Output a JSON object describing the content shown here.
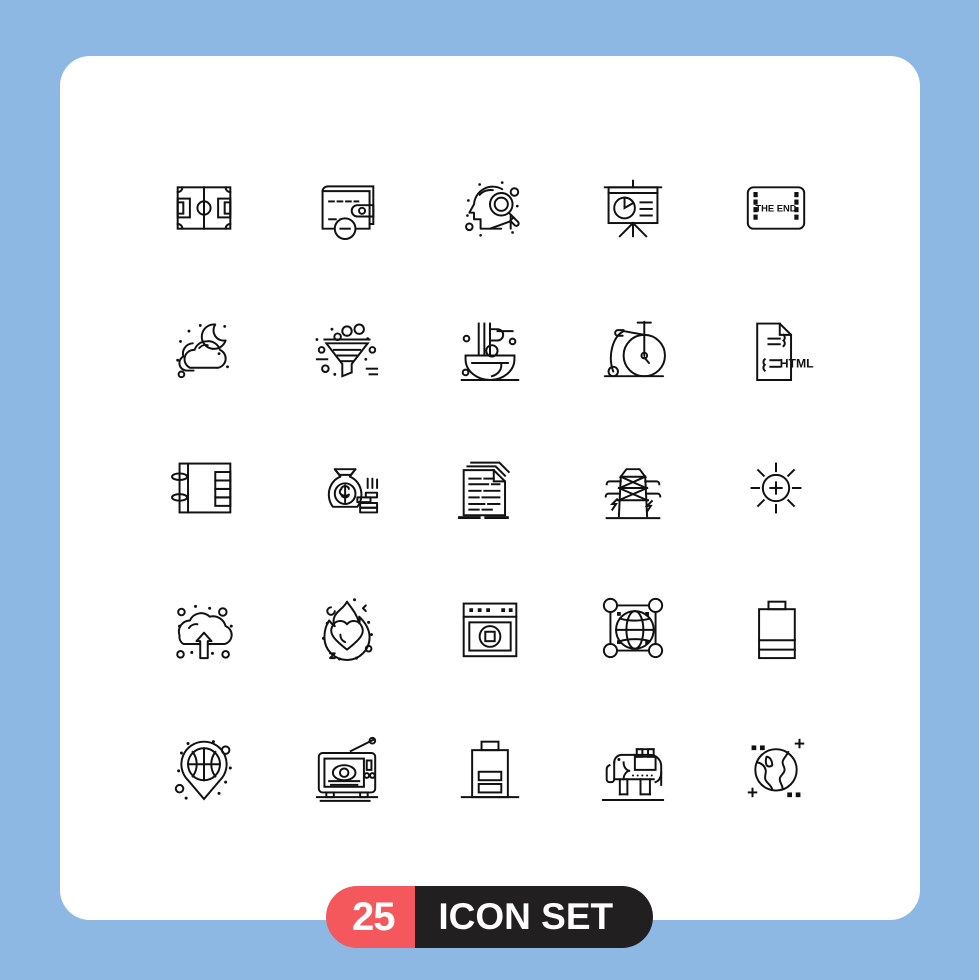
{
  "page": {
    "background_color": "#8db8e3",
    "card_color": "#ffffff",
    "stroke_color": "#111111"
  },
  "banner": {
    "count": "25",
    "label": "ICON SET",
    "count_bg": "#f4585c",
    "label_bg": "#221f20",
    "text_color": "#ffffff"
  },
  "grid": {
    "columns": 5,
    "rows": 5,
    "total": 25
  },
  "icons": [
    {
      "index": 1,
      "name": "soccer-field-icon",
      "label": "Soccer Field",
      "row": 1,
      "col": 1
    },
    {
      "index": 2,
      "name": "wallet-minus-icon",
      "label": "Wallet Remove",
      "row": 1,
      "col": 2
    },
    {
      "index": 3,
      "name": "head-search-icon",
      "label": "Research Thinking",
      "row": 1,
      "col": 3
    },
    {
      "index": 4,
      "name": "presentation-chart-icon",
      "label": "Presentation Board",
      "row": 1,
      "col": 4
    },
    {
      "index": 5,
      "name": "film-the-end-icon",
      "label": "The End Film",
      "row": 1,
      "col": 5,
      "text": "THE END"
    },
    {
      "index": 6,
      "name": "night-cloud-moon-icon",
      "label": "Cloudy Night",
      "row": 2,
      "col": 1
    },
    {
      "index": 7,
      "name": "funnel-filter-icon",
      "label": "Filter Funnel",
      "row": 2,
      "col": 2
    },
    {
      "index": 8,
      "name": "noodles-bowl-icon",
      "label": "Noodle Bowl",
      "row": 2,
      "col": 3
    },
    {
      "index": 9,
      "name": "penny-farthing-bike-icon",
      "label": "Vintage Bicycle",
      "row": 2,
      "col": 4
    },
    {
      "index": 10,
      "name": "html-file-icon",
      "label": "HTML File",
      "row": 2,
      "col": 5,
      "text": "HTML"
    },
    {
      "index": 11,
      "name": "ring-binder-icon",
      "label": "Ring Binder Notebook",
      "row": 3,
      "col": 1
    },
    {
      "index": 12,
      "name": "money-bag-coins-icon",
      "label": "Money Bag",
      "row": 3,
      "col": 2,
      "text": "$"
    },
    {
      "index": 13,
      "name": "documents-stack-icon",
      "label": "Documents Stack",
      "row": 3,
      "col": 3
    },
    {
      "index": 14,
      "name": "power-pylon-icon",
      "label": "Electric Pylon",
      "row": 3,
      "col": 4
    },
    {
      "index": 15,
      "name": "brightness-plus-icon",
      "label": "Increase Brightness",
      "row": 3,
      "col": 5
    },
    {
      "index": 16,
      "name": "cloud-upload-icon",
      "label": "Cloud Upload",
      "row": 4,
      "col": 1
    },
    {
      "index": 17,
      "name": "burning-heart-icon",
      "label": "Burning Heart",
      "row": 4,
      "col": 2
    },
    {
      "index": 18,
      "name": "browser-stop-icon",
      "label": "Browser Stop",
      "row": 4,
      "col": 3
    },
    {
      "index": 19,
      "name": "globe-selection-icon",
      "label": "Globe Transform",
      "row": 4,
      "col": 4
    },
    {
      "index": 20,
      "name": "battery-low-icon",
      "label": "Battery Low",
      "row": 4,
      "col": 5
    },
    {
      "index": 21,
      "name": "basketball-location-icon",
      "label": "Basketball Location",
      "row": 5,
      "col": 1
    },
    {
      "index": 22,
      "name": "tv-eye-icon",
      "label": "Television Watch",
      "row": 5,
      "col": 2
    },
    {
      "index": 23,
      "name": "battery-half-icon",
      "label": "Battery Status",
      "row": 5,
      "col": 3
    },
    {
      "index": 24,
      "name": "elephant-icon",
      "label": "Elephant Ride",
      "row": 5,
      "col": 4
    },
    {
      "index": 25,
      "name": "earth-globe-icon",
      "label": "Planet Earth",
      "row": 5,
      "col": 5
    }
  ]
}
